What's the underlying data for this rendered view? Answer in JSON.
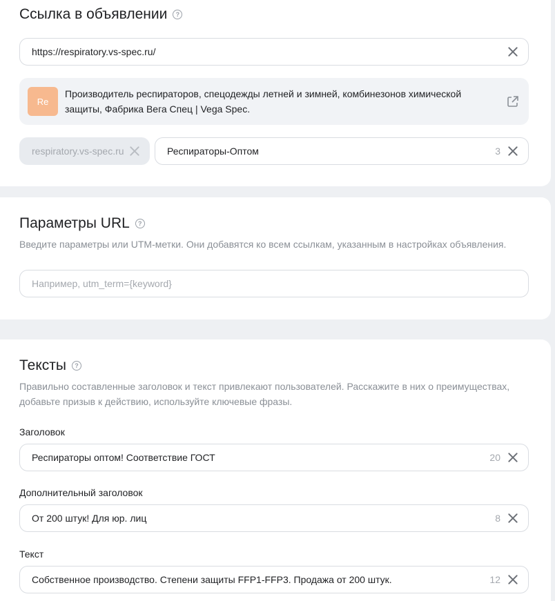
{
  "link_section": {
    "title": "Ссылка в объявлении",
    "url_value": "https://respiratory.vs-spec.ru/",
    "preview": {
      "avatar_text": "Re",
      "text": "Производитель респираторов, спецодежды летней и зимней, комбинезонов химической защиты, Фабрика Вега Спец | Vega Spec."
    },
    "display_domain": "respiratory.vs-spec.ru",
    "display_path": "Респираторы-Оптом",
    "display_path_count": "3"
  },
  "url_params_section": {
    "title": "Параметры URL",
    "description": "Введите параметры или UTM-метки. Они добавятся ко всем ссылкам, указанным в настройках объявления.",
    "placeholder": "Например, utm_term={keyword}"
  },
  "texts_section": {
    "title": "Тексты",
    "description": "Правильно составленные заголовок и текст привлекают пользователей. Расскажите в них о преимуществах, добавьте призыв к действию, используйте ключевые фразы.",
    "headline_label": "Заголовок",
    "headline_value": "Респираторы оптом! Соответствие ГОСТ",
    "headline_count": "20",
    "subheadline_label": "Дополнительный заголовок",
    "subheadline_value": "От 200 штук! Для юр. лиц",
    "subheadline_count": "8",
    "text_label": "Текст",
    "text_value": "Собственное производство. Степени защиты FFP1-FFP3. Продажа от 200 штук.",
    "text_count": "12"
  },
  "colors": {
    "avatar_bg": "#f7b98f",
    "page_bg": "#eef0f3",
    "card_bg": "#ffffff"
  }
}
